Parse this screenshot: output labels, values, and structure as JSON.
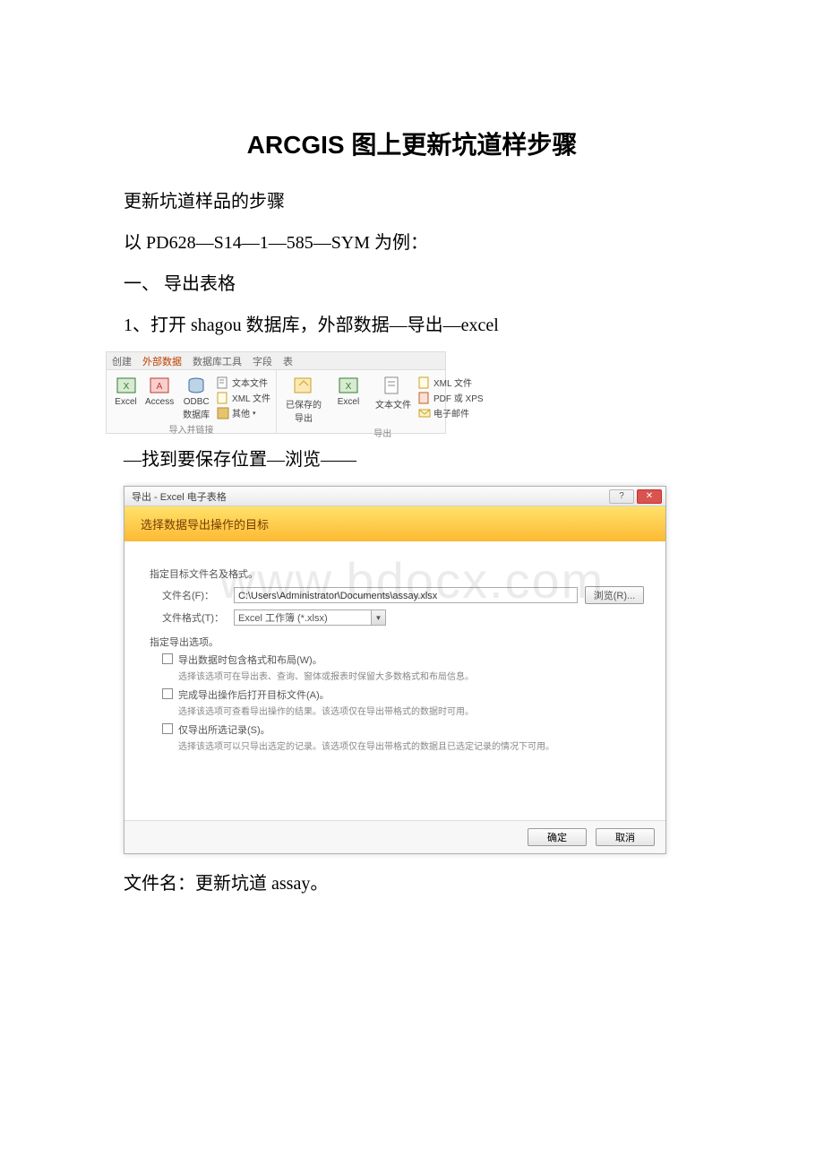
{
  "title": "ARCGIS 图上更新坑道样步骤",
  "paragraphs": {
    "p1": "更新坑道样品的步骤",
    "p2": " 以 PD628—S14—1—585—SYM 为例：",
    "p3": "一、 导出表格",
    "p4": "1、打开 shagou 数据库，外部数据—导出—excel",
    "p5": "—找到要保存位置—浏览——",
    "p6": "文件名：更新坑道 assay。"
  },
  "ribbon": {
    "tabs": [
      "创建",
      "外部数据",
      "数据库工具",
      "字段",
      "表"
    ],
    "active_tab_index": 1,
    "group1": {
      "label": "导入并链接",
      "items": {
        "excel": "Excel",
        "access": "Access",
        "odbc": "ODBC 数据库",
        "text": "文本文件",
        "xml": "XML 文件",
        "other": "其他"
      }
    },
    "group2": {
      "label": "导出",
      "items": {
        "saved": "已保存的导出",
        "excel": "Excel",
        "textfile": "文本文件",
        "xml": "XML 文件",
        "pdf": "PDF 或 XPS",
        "email": "电子邮件"
      }
    }
  },
  "dialog": {
    "window_title": "导出 - Excel 电子表格",
    "subtitle": "选择数据导出操作的目标",
    "section1_label": "指定目标文件名及格式。",
    "filename_label": "文件名(F)：",
    "filename_value": "C:\\Users\\Administrator\\Documents\\assay.xlsx",
    "browse_btn": "浏览(R)...",
    "fileformat_label": "文件格式(T)：",
    "fileformat_value": "Excel 工作簿 (*.xlsx)",
    "section2_label": "指定导出选项。",
    "options": [
      {
        "main": "导出数据时包含格式和布局(W)。",
        "sub": "选择该选项可在导出表、查询、窗体或报表时保留大多数格式和布局信息。"
      },
      {
        "main": "完成导出操作后打开目标文件(A)。",
        "sub": "选择该选项可查看导出操作的结果。该选项仅在导出带格式的数据时可用。"
      },
      {
        "main": "仅导出所选记录(S)。",
        "sub": "选择该选项可以只导出选定的记录。该选项仅在导出带格式的数据且已选定记录的情况下可用。"
      }
    ],
    "ok_btn": "确定",
    "cancel_btn": "取消"
  },
  "watermark": "www.bdocx.com"
}
